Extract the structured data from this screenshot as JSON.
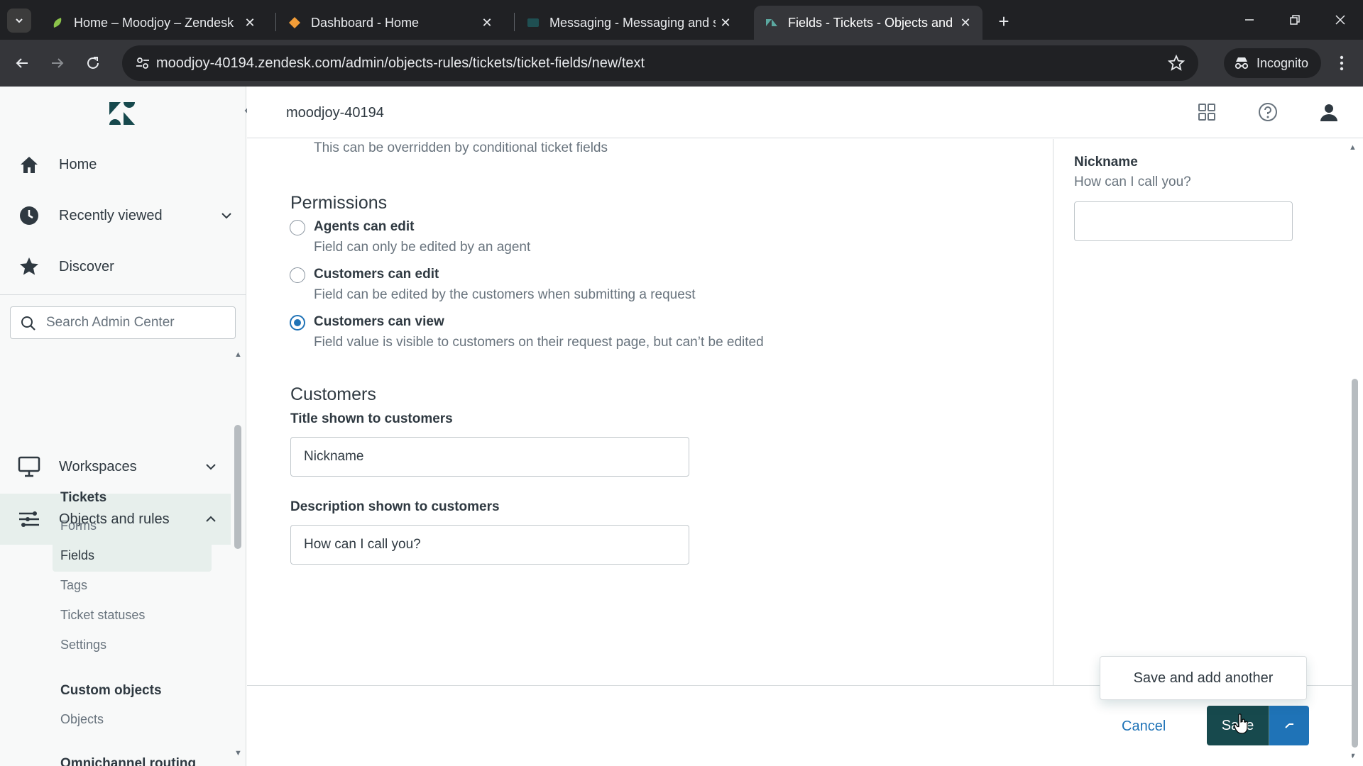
{
  "browser": {
    "tabs": [
      {
        "title": "Home – Moodjoy – Zendesk",
        "active": false
      },
      {
        "title": "Dashboard - Home",
        "active": false
      },
      {
        "title": "Messaging - Messaging and so",
        "active": false
      },
      {
        "title": "Fields - Tickets - Objects and ru",
        "active": true
      }
    ],
    "url": "moodjoy-40194.zendesk.com/admin/objects-rules/tickets/ticket-fields/new/text",
    "incognito_label": "Incognito"
  },
  "header": {
    "account": "moodjoy-40194"
  },
  "sidebar": {
    "nav": [
      {
        "label": "Home",
        "icon": "home-icon"
      },
      {
        "label": "Recently viewed",
        "icon": "clock-icon"
      },
      {
        "label": "Discover",
        "icon": "star-icon"
      }
    ],
    "search_placeholder": "Search Admin Center",
    "sections": [
      {
        "label": "Workspaces",
        "icon": "monitor-icon"
      },
      {
        "label": "Objects and rules",
        "icon": "objects-rules-icon"
      }
    ],
    "tickets_heading": "Tickets",
    "ticket_items": [
      "Forms",
      "Fields",
      "Tags",
      "Ticket statuses",
      "Settings"
    ],
    "custom_objects_heading": "Custom objects",
    "custom_items": [
      "Objects"
    ],
    "omnichannel_heading": "Omnichannel routing"
  },
  "form": {
    "override_hint": "This can be overridden by conditional ticket fields",
    "permissions_title": "Permissions",
    "permissions": [
      {
        "label": "Agents can edit",
        "hint": "Field can only be edited by an agent",
        "selected": false
      },
      {
        "label": "Customers can edit",
        "hint": "Field can be edited by the customers when submitting a request",
        "selected": false
      },
      {
        "label": "Customers can view",
        "hint": "Field value is visible to customers on their request page, but can’t be edited",
        "selected": true
      }
    ],
    "customers_title": "Customers",
    "title_label": "Title shown to customers",
    "title_value": "Nickname",
    "description_label": "Description shown to customers",
    "description_value": "How can I call you?"
  },
  "preview": {
    "title": "Nickname",
    "description": "How can I call you?"
  },
  "footer": {
    "cancel_label": "Cancel",
    "save_label": "Save",
    "menu_item": "Save and add another"
  },
  "colors": {
    "brand_dark": "#17494d",
    "accent_blue": "#1f73b7",
    "sidebar_active": "#e7efec"
  }
}
